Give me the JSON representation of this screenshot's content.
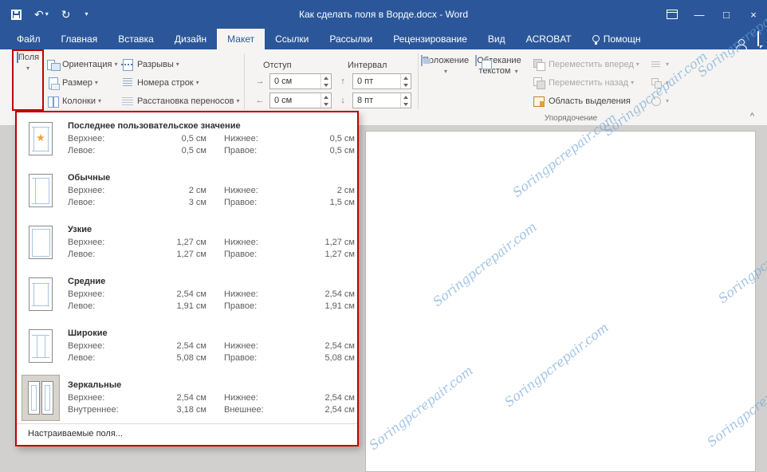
{
  "titlebar": {
    "title": "Как сделать поля в Ворде.docx - Word"
  },
  "tabs": {
    "file": "Файл",
    "home": "Главная",
    "insert": "Вставка",
    "design": "Дизайн",
    "layout": "Макет",
    "references": "Ссылки",
    "mailings": "Рассылки",
    "review": "Рецензирование",
    "view": "Вид",
    "acrobat": "ACROBAT",
    "assistant": "Помощн"
  },
  "ribbon": {
    "margins_label": "Поля",
    "orientation": "Ориентация",
    "size": "Размер",
    "columns": "Колонки",
    "breaks": "Разрывы",
    "line_numbers": "Номера строк",
    "hyphenation": "Расстановка переносов",
    "indent_title": "Отступ",
    "spacing_title": "Интервал",
    "indent_left_value": "0 см",
    "indent_right_value": "0 см",
    "spacing_before_value": "0 пт",
    "spacing_after_value": "8 пт",
    "position": "Положение",
    "wrap_text": "Обтекание текстом",
    "bring_forward": "Переместить вперед",
    "send_backward": "Переместить назад",
    "selection_pane": "Область выделения",
    "arrange_group_label": "Упорядочение"
  },
  "margins_menu": {
    "presets": [
      {
        "title": "Последнее пользовательское значение",
        "rows": [
          {
            "a": "Верхнее:",
            "av": "0,5 см",
            "b": "Нижнее:",
            "bv": "0,5 см"
          },
          {
            "a": "Левое:",
            "av": "0,5 см",
            "b": "Правое:",
            "bv": "0,5 см"
          }
        ]
      },
      {
        "title": "Обычные",
        "rows": [
          {
            "a": "Верхнее:",
            "av": "2 см",
            "b": "Нижнее:",
            "bv": "2 см"
          },
          {
            "a": "Левое:",
            "av": "3 см",
            "b": "Правое:",
            "bv": "1,5 см"
          }
        ]
      },
      {
        "title": "Узкие",
        "rows": [
          {
            "a": "Верхнее:",
            "av": "1,27 см",
            "b": "Нижнее:",
            "bv": "1,27 см"
          },
          {
            "a": "Левое:",
            "av": "1,27 см",
            "b": "Правое:",
            "bv": "1,27 см"
          }
        ]
      },
      {
        "title": "Средние",
        "rows": [
          {
            "a": "Верхнее:",
            "av": "2,54 см",
            "b": "Нижнее:",
            "bv": "2,54 см"
          },
          {
            "a": "Левое:",
            "av": "1,91 см",
            "b": "Правое:",
            "bv": "1,91 см"
          }
        ]
      },
      {
        "title": "Широкие",
        "rows": [
          {
            "a": "Верхнее:",
            "av": "2,54 см",
            "b": "Нижнее:",
            "bv": "2,54 см"
          },
          {
            "a": "Левое:",
            "av": "5,08 см",
            "b": "Правое:",
            "bv": "5,08 см"
          }
        ]
      },
      {
        "title": "Зеркальные",
        "rows": [
          {
            "a": "Верхнее:",
            "av": "2,54 см",
            "b": "Нижнее:",
            "bv": "2,54 см"
          },
          {
            "a": "Внутреннее:",
            "av": "3,18 см",
            "b": "Внешнее:",
            "bv": "2,54 см"
          }
        ]
      }
    ],
    "custom_item": "Настраиваемые поля..."
  },
  "watermark": {
    "text": "Soringpcrepair.com"
  },
  "colors": {
    "accent": "#2b579a",
    "highlight": "#c00000"
  },
  "glyphs": {
    "caret_down": "▾",
    "undo": "↶",
    "redo": "↻",
    "minimize": "—",
    "maximize": "□",
    "close": "×",
    "star": "★",
    "collapse": "^",
    "arrow_right": "→",
    "arrow_left": "←",
    "arrow_up": "↑",
    "arrow_down": "↓"
  }
}
